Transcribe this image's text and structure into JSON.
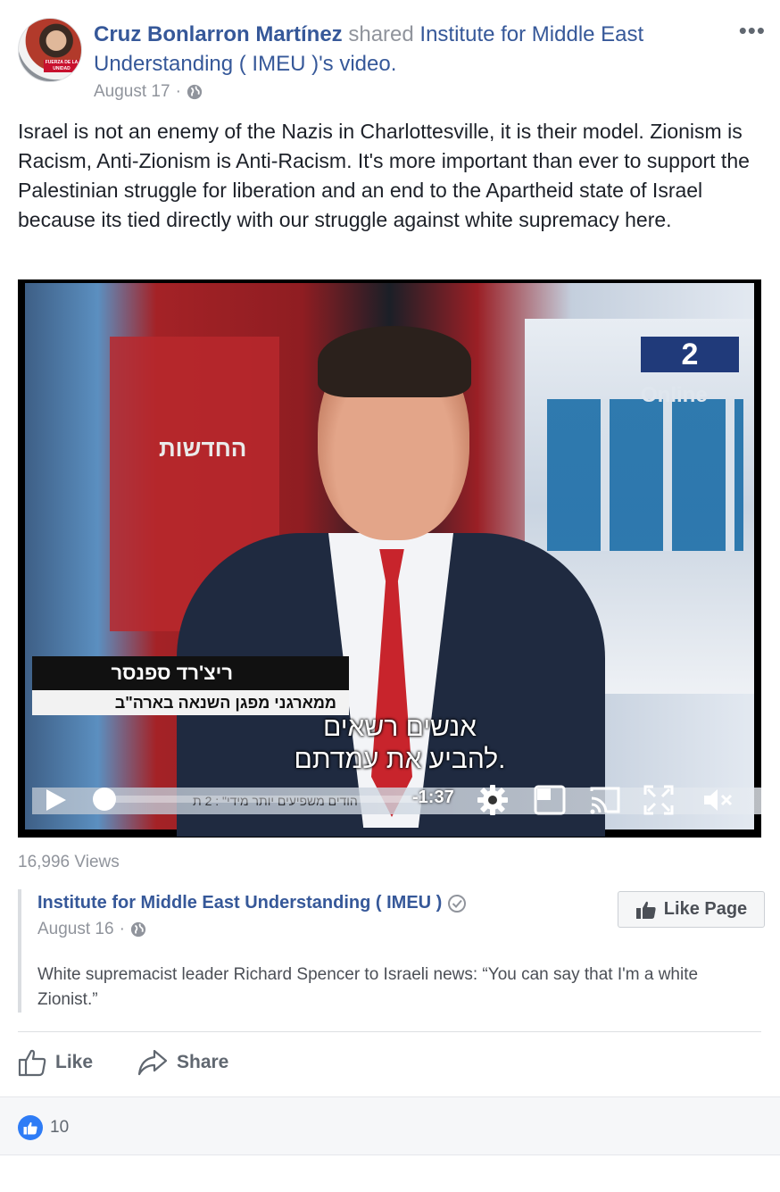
{
  "post": {
    "author": "Cruz Bonlarron Martínez",
    "action": " shared ",
    "shared_page_link": "Institute for Middle East Understanding ( IMEU )'s video.",
    "date": "August 17",
    "meta_separator": "·",
    "privacy_icon": "globe-icon",
    "more_options": "•••",
    "avatar_badge": "FUERZA DE LA UNIDAD",
    "text": "Israel is not an enemy of the Nazis in Charlottesville, it is their model. Zionism is Racism, Anti-Zionism is Anti-Racism. It's more important than ever to support the Palestinian struggle for liberation and an end to the Apartheid state of Israel because its tied directly with our struggle against white supremacy here."
  },
  "video": {
    "channel_logo": "2",
    "channel_online": "Online",
    "studio_wall_text": "החדשות",
    "lower_third_name": "ריצ'רד ספנסר",
    "lower_third_sub": "ממארגני מפגן השנאה בארה\"ב",
    "subtitle_line1": "אנשים רשאים",
    "subtitle_line2": "להביע את עמדתם.",
    "ticker": "הודים משפיעים יותר מידי\" : 2 ת",
    "time_remaining": "-1:37",
    "progress": 0.0,
    "controls": [
      "play-icon",
      "gear-icon",
      "picture-in-picture-icon",
      "cast-icon",
      "fullscreen-icon",
      "mute-icon"
    ]
  },
  "views": "16,996 Views",
  "shared_post": {
    "page_name": "Institute for Middle East Understanding ( IMEU )",
    "date": "August 16",
    "meta_separator": "·",
    "text": "White supremacist leader Richard Spencer to Israeli news: “You can say that I'm a white Zionist.”",
    "like_page_label": "Like Page"
  },
  "actions": {
    "like_label": "Like",
    "share_label": "Share"
  },
  "reactions": {
    "count": "10"
  },
  "colors": {
    "link_blue": "#365899",
    "meta_gray": "#90949c",
    "reaction_blue": "#2e7cf6"
  }
}
